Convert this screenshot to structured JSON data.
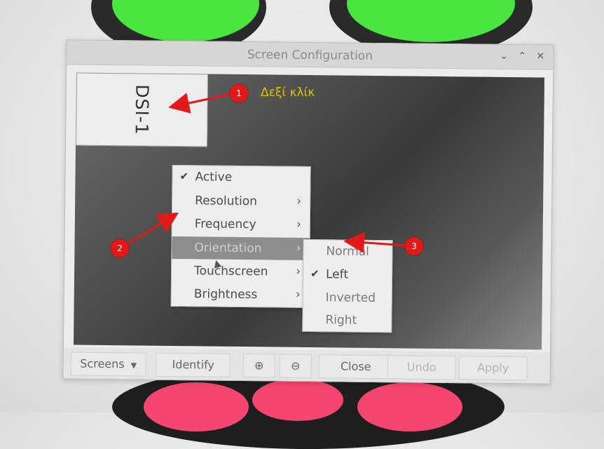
{
  "window": {
    "title": "Screen Configuration",
    "controls": [
      "⌄",
      "⌃",
      "✕"
    ]
  },
  "monitor": {
    "label": "DSI-1"
  },
  "context_menu": {
    "items": [
      {
        "label": "Active",
        "checked": true,
        "submenu": false
      },
      {
        "label": "Resolution",
        "checked": false,
        "submenu": true
      },
      {
        "label": "Frequency",
        "checked": false,
        "submenu": true
      },
      {
        "label": "Orientation",
        "checked": false,
        "submenu": true,
        "highlighted": true
      },
      {
        "label": "Touchscreen",
        "checked": false,
        "submenu": true
      },
      {
        "label": "Brightness",
        "checked": false,
        "submenu": true
      }
    ],
    "check_glyph": "✔",
    "arrow_glyph": "›"
  },
  "orientation_submenu": {
    "items": [
      {
        "label": "Normal",
        "checked": false
      },
      {
        "label": "Left",
        "checked": true
      },
      {
        "label": "Inverted",
        "checked": false
      },
      {
        "label": "Right",
        "checked": false
      }
    ]
  },
  "footer": {
    "screens_label": "Screens",
    "screens_arrow": "▼",
    "identify_label": "Identify",
    "zoom_in_glyph": "⊕",
    "zoom_out_glyph": "⊖",
    "close_label": "Close",
    "undo_label": "Undo",
    "apply_label": "Apply"
  },
  "annotations": {
    "marker_1": "1",
    "marker_2": "2",
    "marker_3": "3",
    "text_1": "Δεξί κλίκ",
    "color": "#e31818"
  }
}
